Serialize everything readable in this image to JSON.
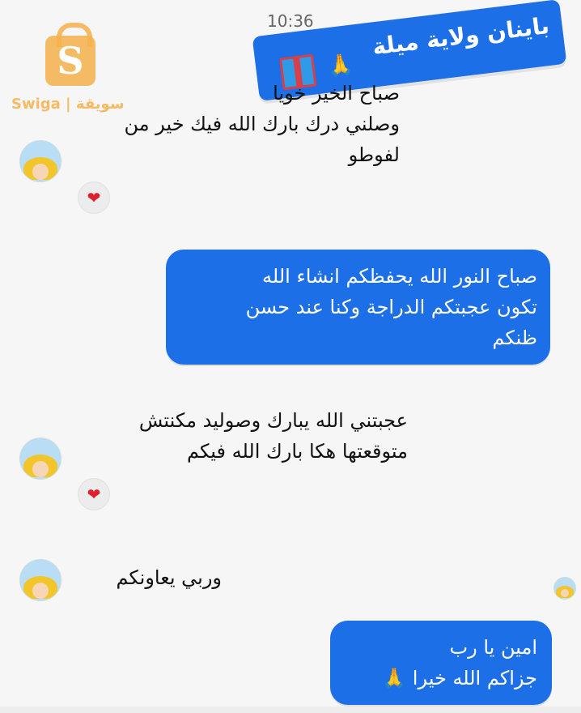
{
  "status_bar": {
    "time": "10:36"
  },
  "watermark": {
    "brand": "Swiga | سويقة"
  },
  "banner": {
    "title": "باينان ولاية ميلة",
    "emoji": "🙏"
  },
  "messages": [
    {
      "side": "received",
      "lines": [
        "صباح الخير خويا",
        "وصلني درك بارك الله فيك خير من",
        "لفوطو"
      ],
      "reaction": "❤"
    },
    {
      "side": "sent",
      "lines": [
        "صباح النور الله يحفظكم انشاء الله",
        "تكون عجبتكم الدراجة وكنا عند حسن",
        "ظنكم"
      ]
    },
    {
      "side": "received",
      "lines": [
        "عجبتني الله يبارك وصوليد مكنتش",
        "متوقعتها هكا بارك الله فيكم"
      ],
      "reaction": "❤"
    },
    {
      "side": "received",
      "lines": [
        "وربي يعاونكم"
      ]
    },
    {
      "side": "sent",
      "lines": [
        "امين يا رب",
        "جزاكم الله خيرا 🙏"
      ]
    }
  ]
}
